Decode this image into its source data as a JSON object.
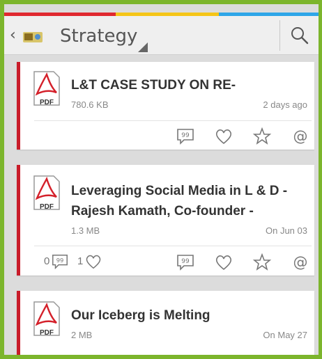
{
  "header": {
    "title": "Strategy",
    "back_icon": "chevron-left-icon",
    "app_icon": "app-logo-icon",
    "search_icon": "search-icon"
  },
  "colors": {
    "frame": "#7cb52c",
    "accent_red": "#c91c2a",
    "bar_red": "#e0282f",
    "bar_yellow": "#f5c518",
    "bar_blue": "#2ea6e8"
  },
  "documents": [
    {
      "type_label": "PDF",
      "title": "L&T CASE STUDY ON RE-",
      "size": "780.6 KB",
      "date": "2 days ago",
      "actions": [
        "comment-icon",
        "heart-icon",
        "star-icon",
        "at-icon"
      ]
    },
    {
      "type_label": "PDF",
      "title_line1": "Leveraging Social Media in L & D -",
      "title_line2": "Rajesh Kamath, Co-founder -",
      "size": "1.3 MB",
      "date": "On Jun 03",
      "comment_count": "0",
      "like_count": "1",
      "actions": [
        "comment-icon",
        "heart-icon",
        "star-icon",
        "at-icon"
      ]
    },
    {
      "type_label": "PDF",
      "title": "Our Iceberg is Melting",
      "size": "2 MB",
      "date": "On May 27"
    }
  ]
}
